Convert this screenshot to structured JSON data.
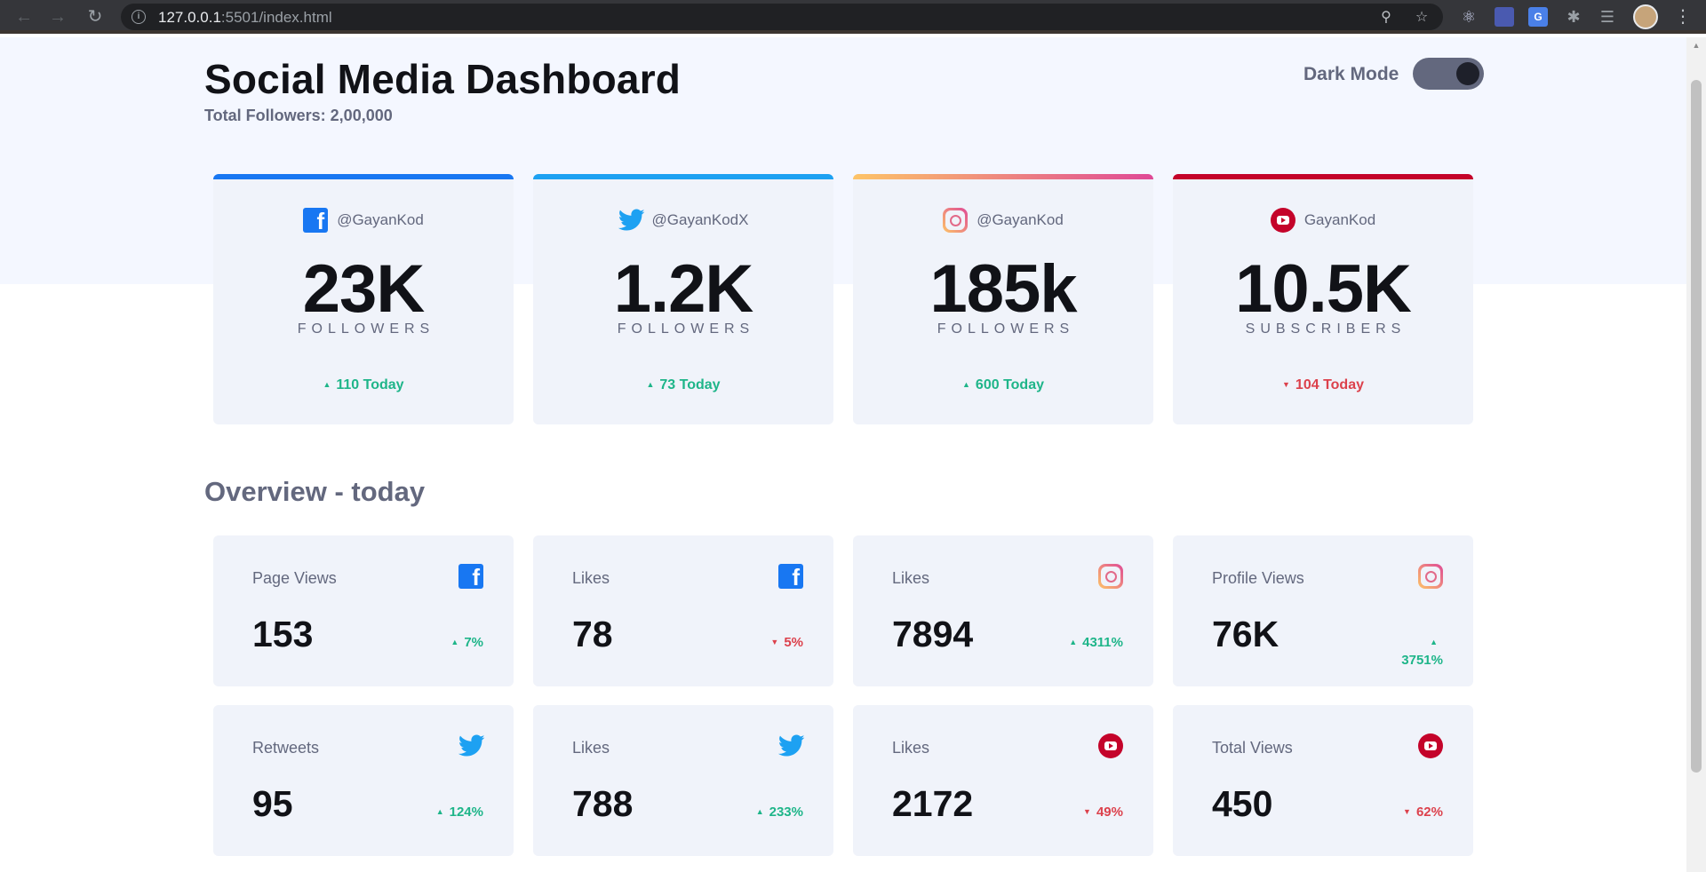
{
  "browser": {
    "url_host": "127.0.0.1",
    "url_rest": ":5501/index.html"
  },
  "header": {
    "title": "Social Media Dashboard",
    "total_followers": "Total Followers: 2,00,000",
    "dark_mode_label": "Dark Mode",
    "dark_mode_on": true
  },
  "colors": {
    "facebook": "#1877f2",
    "twitter": "#1da1f2",
    "instagram_start": "#fdc468",
    "instagram_end": "#df4996",
    "youtube": "#c4032a",
    "up": "#1eb589",
    "down": "#dc414c"
  },
  "follower_cards": [
    {
      "platform": "facebook",
      "icon": "facebook-icon",
      "handle": "@GayanKod",
      "count": "23K",
      "label": "FOLLOWERS",
      "today": "110 Today",
      "trend": "up"
    },
    {
      "platform": "twitter",
      "icon": "twitter-icon",
      "handle": "@GayanKodX",
      "count": "1.2K",
      "label": "FOLLOWERS",
      "today": "73 Today",
      "trend": "up"
    },
    {
      "platform": "instagram",
      "icon": "instagram-icon",
      "handle": "@GayanKod",
      "count": "185k",
      "label": "FOLLOWERS",
      "today": "600 Today",
      "trend": "up"
    },
    {
      "platform": "youtube",
      "icon": "youtube-icon",
      "handle": "GayanKod",
      "count": "10.5K",
      "label": "SUBSCRIBERS",
      "today": "104 Today",
      "trend": "down"
    }
  ],
  "overview": {
    "title": "Overview - today",
    "cards": [
      {
        "label": "Page Views",
        "platform": "facebook",
        "value": "153",
        "pct": "7%",
        "trend": "up"
      },
      {
        "label": "Likes",
        "platform": "facebook",
        "value": "78",
        "pct": "5%",
        "trend": "down"
      },
      {
        "label": "Likes",
        "platform": "instagram",
        "value": "7894",
        "pct": "4311%",
        "trend": "up"
      },
      {
        "label": "Profile Views",
        "platform": "instagram",
        "value": "76K",
        "pct": "3751%",
        "trend": "up"
      },
      {
        "label": "Retweets",
        "platform": "twitter",
        "value": "95",
        "pct": "124%",
        "trend": "up"
      },
      {
        "label": "Likes",
        "platform": "twitter",
        "value": "788",
        "pct": "233%",
        "trend": "up"
      },
      {
        "label": "Likes",
        "platform": "youtube",
        "value": "2172",
        "pct": "49%",
        "trend": "down"
      },
      {
        "label": "Total Views",
        "platform": "youtube",
        "value": "450",
        "pct": "62%",
        "trend": "down"
      }
    ]
  }
}
